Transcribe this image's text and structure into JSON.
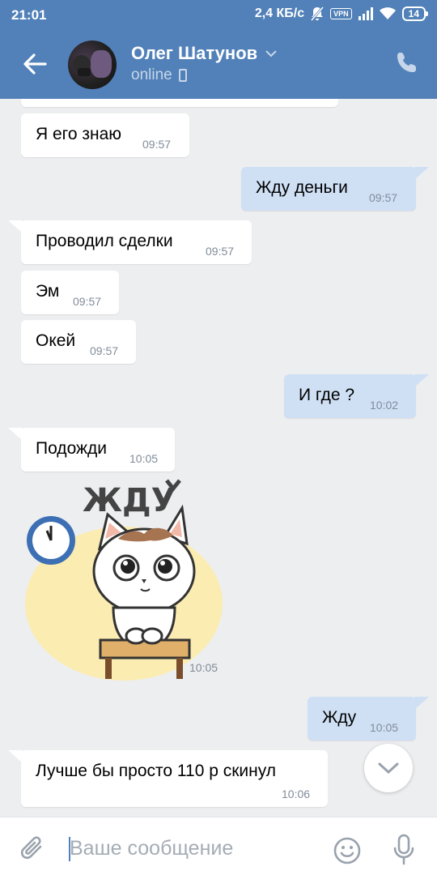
{
  "status": {
    "time": "21:01",
    "speed": "2,4 КБ/с",
    "vpn": "VPN",
    "battery": "14"
  },
  "header": {
    "name": "Олег Шатунов",
    "presence": "online"
  },
  "messages": [
    {
      "dir": "in",
      "text": "Я его знаю",
      "time": "09:57"
    },
    {
      "dir": "out",
      "text": "Жду деньги",
      "time": "09:57"
    },
    {
      "dir": "in",
      "text": "Проводил сделки",
      "time": "09:57"
    },
    {
      "dir": "in",
      "text": "Эм",
      "time": "09:57"
    },
    {
      "dir": "in",
      "text": "Окей",
      "time": "09:57"
    },
    {
      "dir": "out",
      "text": "И где ?",
      "time": "10:02"
    },
    {
      "dir": "in",
      "text": "Подожди",
      "time": "10:05"
    },
    {
      "dir": "in",
      "sticker": "ЖДУ",
      "time": "10:05"
    },
    {
      "dir": "out",
      "text": "Жду",
      "time": "10:05"
    },
    {
      "dir": "in",
      "text": "Лучше бы просто 110 р скинул",
      "time": "10:06"
    }
  ],
  "composer": {
    "placeholder": "Ваше сообщение"
  },
  "colors": {
    "header": "#5181b8",
    "background": "#edeef0",
    "outgoing": "#cfe0f5",
    "incoming": "#ffffff",
    "timestamp": "#818c99"
  },
  "icons": [
    "back-arrow-icon",
    "chevron-down-icon",
    "phone-icon",
    "call-icon",
    "paperclip-icon",
    "smile-icon",
    "microphone-icon",
    "scroll-down-icon"
  ]
}
